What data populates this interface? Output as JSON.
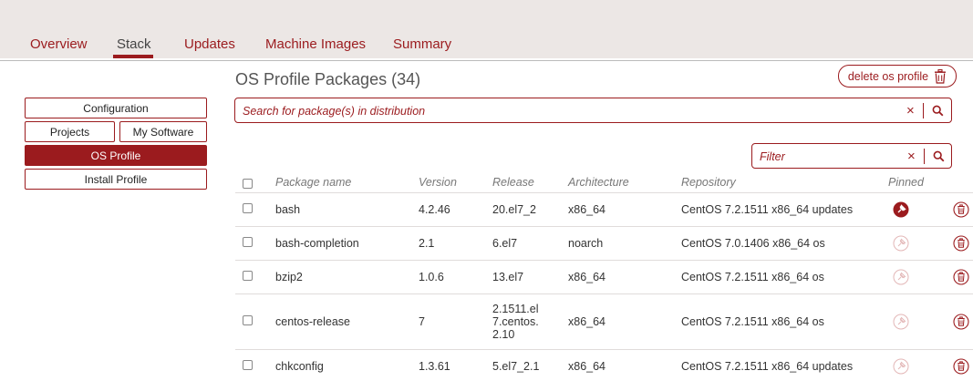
{
  "tabs": [
    "Overview",
    "Stack",
    "Updates",
    "Machine Images",
    "Summary"
  ],
  "active_tab": "Stack",
  "sidebar": {
    "configuration": "Configuration",
    "projects": "Projects",
    "my_software": "My Software",
    "os_profile": "OS Profile",
    "install_profile": "Install Profile"
  },
  "main": {
    "title": "OS Profile Packages (34)",
    "delete_label": "delete os profile",
    "search_placeholder": "Search for package(s) in distribution",
    "filter_placeholder": "Filter"
  },
  "table": {
    "headers": [
      "Package name",
      "Version",
      "Release",
      "Architecture",
      "Repository",
      "Pinned"
    ],
    "rows": [
      {
        "name": "bash",
        "version": "4.2.46",
        "release": [
          "20.el7_2"
        ],
        "arch": "x86_64",
        "repo": "CentOS 7.2.1511 x86_64 updates",
        "pinned": true
      },
      {
        "name": "bash-completion",
        "version": "2.1",
        "release": [
          "6.el7"
        ],
        "arch": "noarch",
        "repo": "CentOS 7.0.1406 x86_64 os",
        "pinned": false
      },
      {
        "name": "bzip2",
        "version": "1.0.6",
        "release": [
          "13.el7"
        ],
        "arch": "x86_64",
        "repo": "CentOS 7.2.1511 x86_64 os",
        "pinned": false
      },
      {
        "name": "centos-release",
        "version": "7",
        "release": [
          "2.1511.el",
          "7.centos.",
          "2.10"
        ],
        "arch": "x86_64",
        "repo": "CentOS 7.2.1511 x86_64 os",
        "pinned": false
      },
      {
        "name": "chkconfig",
        "version": "1.3.61",
        "release": [
          "5.el7_2.1"
        ],
        "arch": "x86_64",
        "repo": "CentOS 7.2.1511 x86_64 updates",
        "pinned": false
      }
    ]
  },
  "colors": {
    "accent": "#9b1b1e",
    "topbar": "#ece7e5",
    "pin_off": "#e3b7b7"
  },
  "icons": {
    "clear": "close-icon",
    "search": "magnifier-icon",
    "pin": "pin-icon",
    "trash": "trash-icon"
  }
}
